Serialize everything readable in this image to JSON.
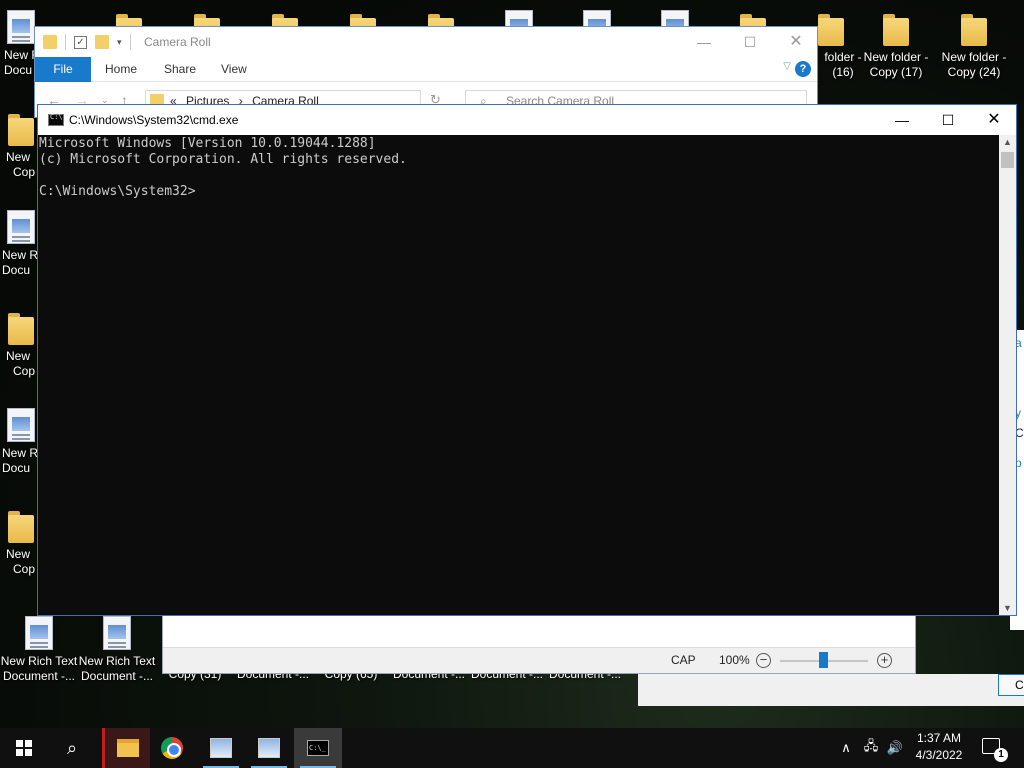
{
  "desktop": {
    "top_icons_right": [
      {
        "line1": "folder -",
        "line2": "(16)"
      },
      {
        "line1": "New folder -",
        "line2": "Copy (17)"
      },
      {
        "line1": "New folder -",
        "line2": "Copy (24)"
      }
    ],
    "left_icons": [
      {
        "line1": "New R",
        "line2": "Docu"
      },
      {
        "line1": "New",
        "line2": "Cop"
      },
      {
        "line1": "New R",
        "line2": "Docu"
      },
      {
        "line1": "New",
        "line2": "Cop"
      },
      {
        "line1": "New R",
        "line2": "Docu"
      },
      {
        "line1": "New",
        "line2": "Cop"
      }
    ],
    "bottom_icons": [
      {
        "line1": "New Rich Text",
        "line2": "Document -..."
      },
      {
        "line1": "New Rich Text",
        "line2": "Document -..."
      }
    ],
    "bottom_labels": [
      "Copy (31)",
      "Document -...",
      "Copy (65)",
      "Document -...",
      "Document -...",
      "Document -..."
    ]
  },
  "explorer": {
    "title": "Camera Roll",
    "ribbon_tabs": [
      "File",
      "Home",
      "Share",
      "View"
    ],
    "breadcrumb": {
      "prefix": "«",
      "parts": [
        "Pictures",
        "›",
        "Camera Roll"
      ]
    },
    "search_placeholder": "Search Camera Roll",
    "status": {
      "cap": "CAP",
      "zoom": "100%"
    },
    "zoom_level_percent": 100
  },
  "cmd": {
    "title": "C:\\Windows\\System32\\cmd.exe",
    "lines": [
      "Microsoft Windows [Version 10.0.19044.1288]",
      "(c) Microsoft Corporation. All rights reserved.",
      "",
      "C:\\Windows\\System32>"
    ]
  },
  "taskbar": {
    "apps": [
      "start",
      "search",
      "file-explorer",
      "chrome",
      "paint",
      "photos",
      "cmd"
    ],
    "clock": {
      "time": "1:37 AM",
      "date": "4/3/2022"
    },
    "notification_count": "1"
  },
  "colors": {
    "accent": "#1979ca",
    "console_bg": "#0c0c0c",
    "console_fg": "#cccccc",
    "taskbar_bg": "#101010",
    "explorer_active": "#c21c1c"
  }
}
